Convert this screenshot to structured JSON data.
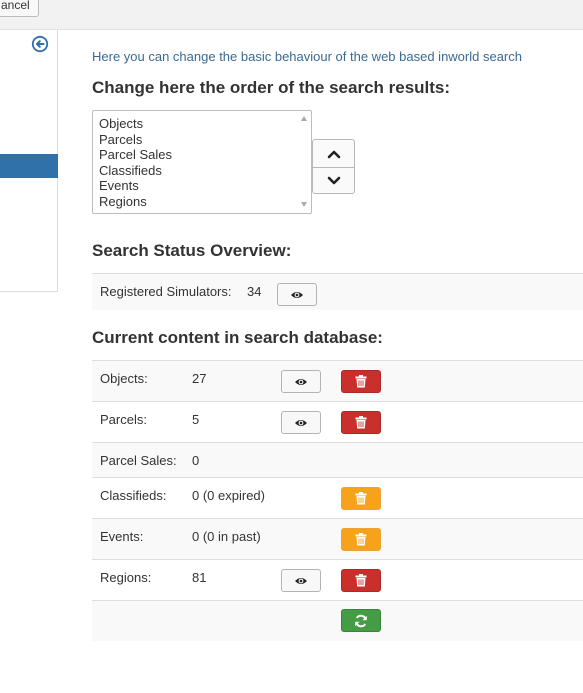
{
  "topbar": {
    "cancel_label": "ancel"
  },
  "sidebar": {
    "collapse_icon": "circle-arrow-left-icon"
  },
  "intro_text": "Here you can change the basic behaviour of the web based inworld search",
  "order": {
    "heading": "Change here the order of the search results:",
    "options": [
      "Objects",
      "Parcels",
      "Parcel Sales",
      "Classifieds",
      "Events",
      "Regions"
    ],
    "up_icon": "chevron-up-icon",
    "down_icon": "chevron-down-icon"
  },
  "status": {
    "heading": "Search Status Overview:",
    "registered_label": "Registered Simulators:",
    "registered_value": "34"
  },
  "content": {
    "heading": "Current content in search database:",
    "rows": [
      {
        "label": "Objects:",
        "value": "27"
      },
      {
        "label": "Parcels:",
        "value": "5"
      },
      {
        "label": "Parcel Sales:",
        "value": "0"
      },
      {
        "label": "Classifieds:",
        "value": "0 (0 expired)"
      },
      {
        "label": "Events:",
        "value": "0 (0 in past)"
      },
      {
        "label": "Regions:",
        "value": "81"
      }
    ]
  },
  "colors": {
    "link": "#3a6a93",
    "active": "#3071a9",
    "danger": "#c9302c",
    "warning": "#f7a21b",
    "success": "#449d44"
  }
}
